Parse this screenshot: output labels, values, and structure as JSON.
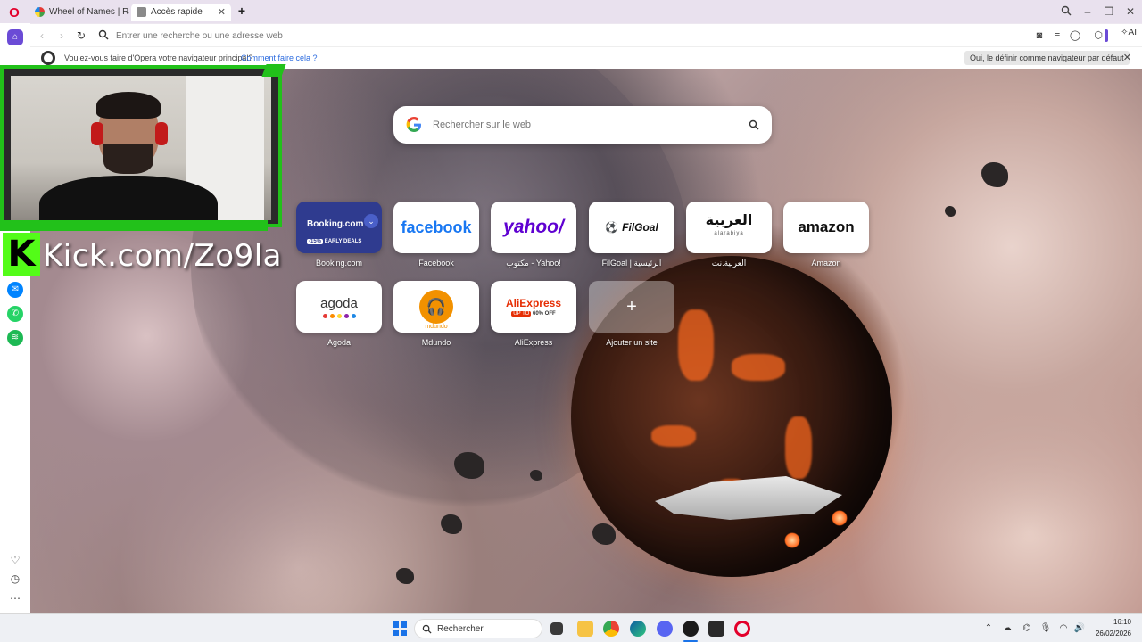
{
  "tabs": [
    {
      "label": "Wheel of Names | Rando",
      "active": false
    },
    {
      "label": "Accès rapide",
      "active": true
    }
  ],
  "address": {
    "placeholder": "Entrer une recherche ou une adresse web",
    "ai_label": "AI"
  },
  "infobar": {
    "message": "Voulez-vous faire d'Opera votre navigateur principal?",
    "link": "Comment faire cela ?",
    "button": "Oui, le définir comme navigateur par défaut"
  },
  "overlay": {
    "kick_letter": "K",
    "kick_url": "Kick.com/Zo9la"
  },
  "search": {
    "placeholder": "Rechercher sur le web"
  },
  "speed_dial": [
    {
      "label": "Booking.com",
      "brand": "Booking.com",
      "extra": "-15%",
      "extra2": "EARLY DEALS"
    },
    {
      "label": "Facebook",
      "brand": "facebook"
    },
    {
      "label": "مكتوب - Yahoo!",
      "brand": "yahoo/"
    },
    {
      "label": "FilGoal | الرئيسية",
      "brand": "FilGoal"
    },
    {
      "label": "العربية.نت",
      "brand": "العربية",
      "extra": "alarabiya"
    },
    {
      "label": "Amazon",
      "brand": "amazon"
    },
    {
      "label": "Agoda",
      "brand": "agoda"
    },
    {
      "label": "Mdundo",
      "brand": "mdundo"
    },
    {
      "label": "AliExpress",
      "brand": "AliExpress",
      "extra": "UP TO",
      "extra2": "60% OFF"
    },
    {
      "label": "Ajouter un site",
      "brand": "+"
    }
  ],
  "taskbar": {
    "search_label": "Rechercher",
    "time": "16:10",
    "date": "26/02/2026"
  },
  "colors": {
    "opera_red": "#e3002b",
    "kick_green": "#53fc18",
    "accent_purple": "#6b4bd6"
  }
}
